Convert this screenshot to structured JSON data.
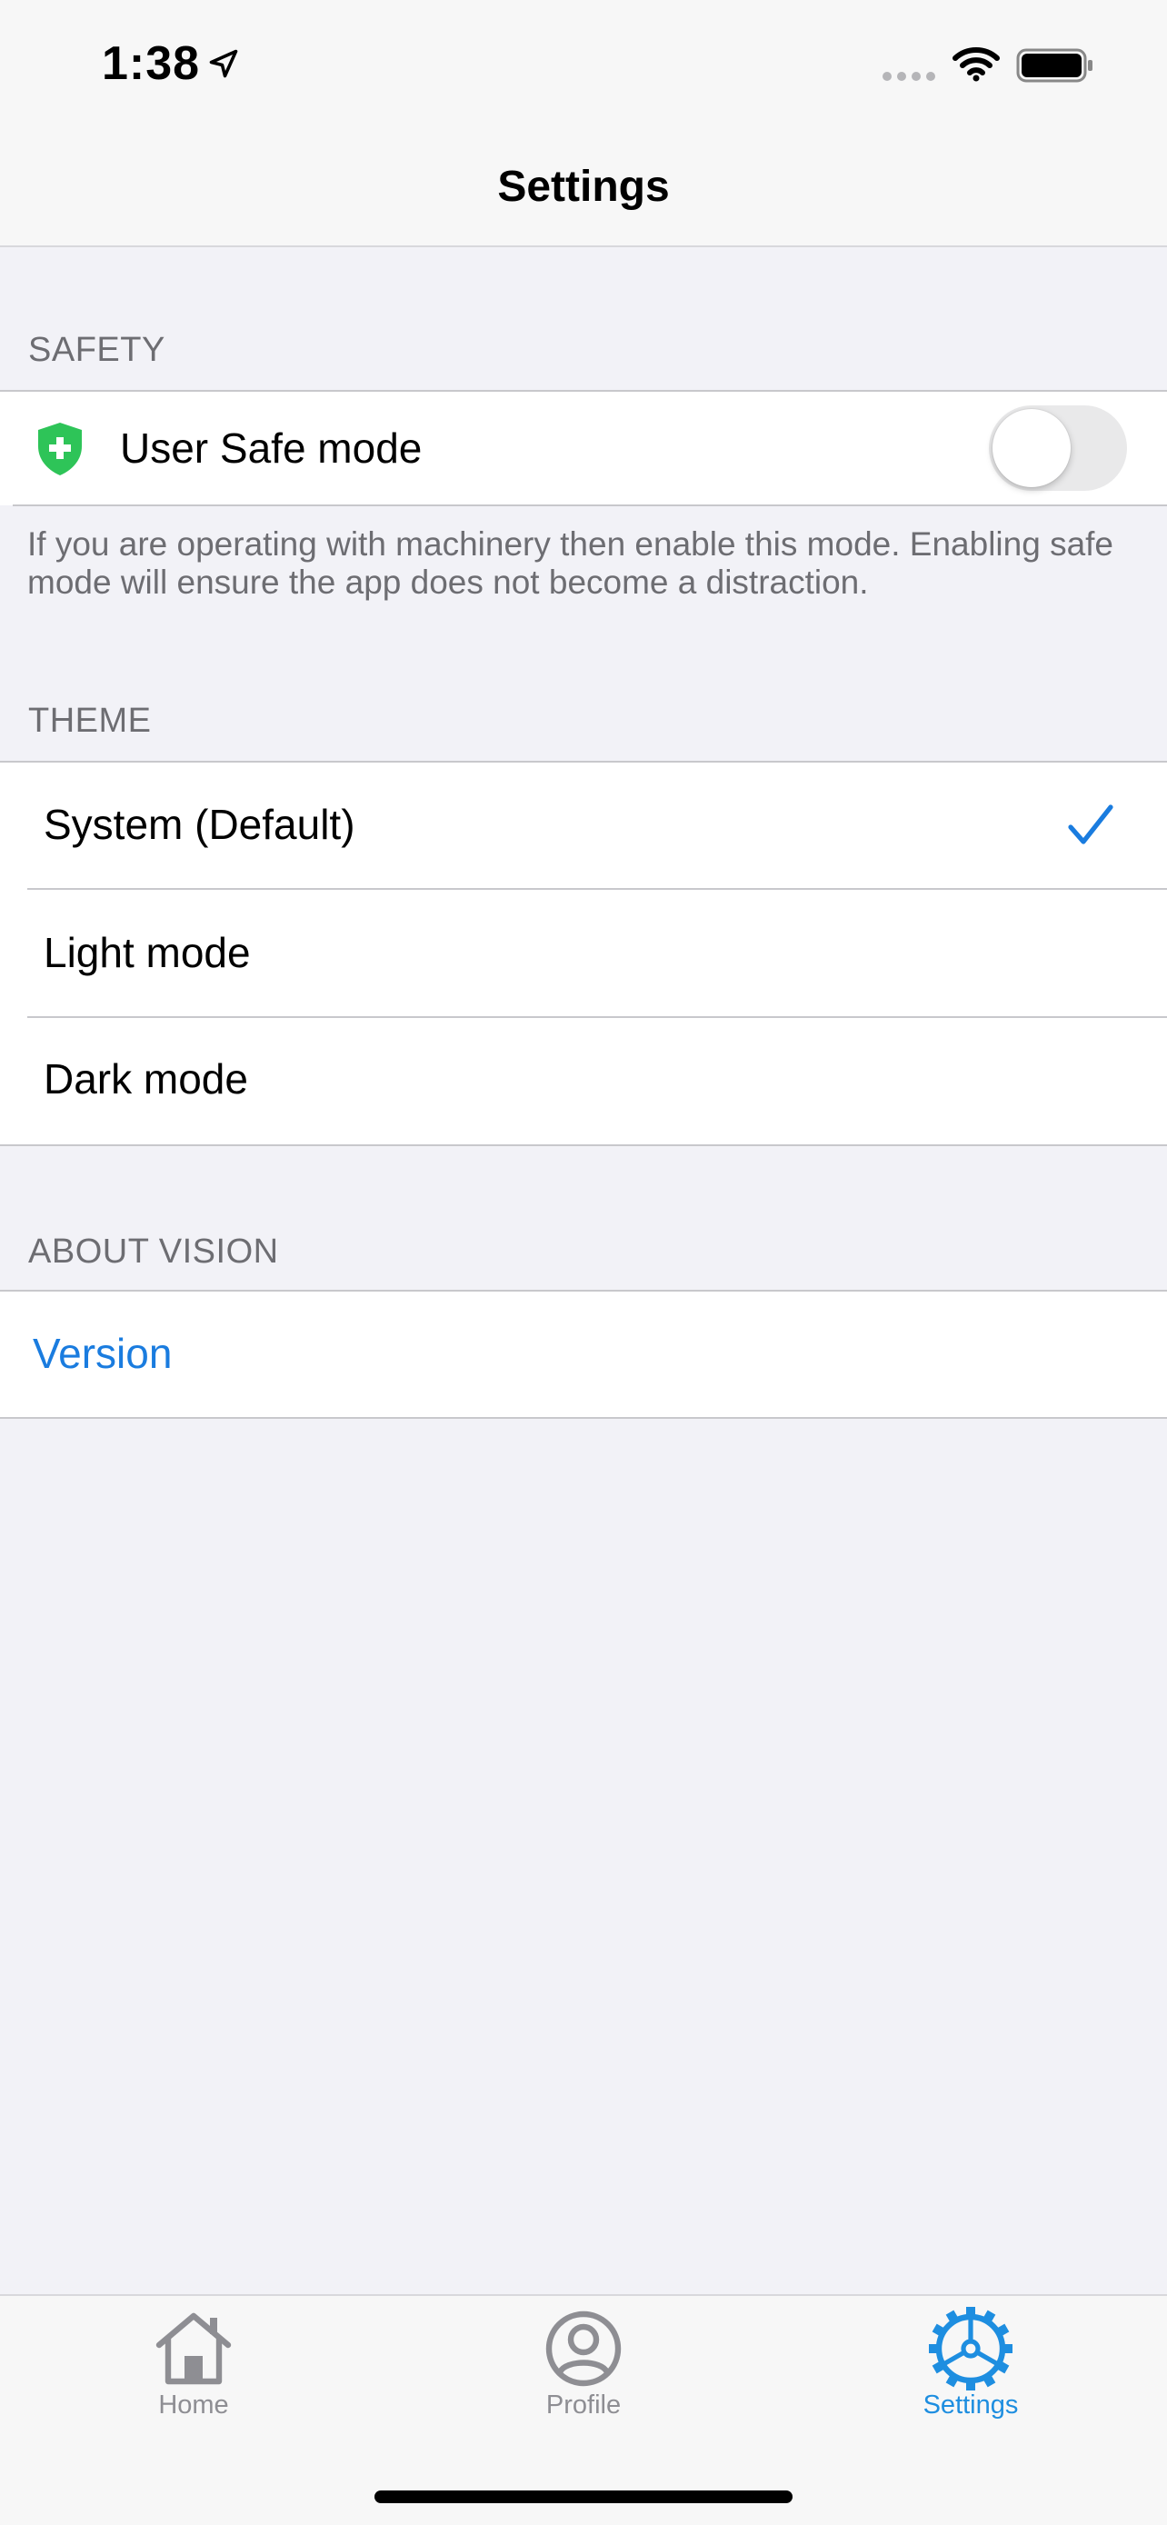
{
  "status_bar": {
    "time": "1:38",
    "icons": [
      "location-arrow-icon",
      "signal-icon",
      "wifi-icon",
      "battery-icon"
    ]
  },
  "nav": {
    "title": "Settings"
  },
  "sections": {
    "safety": {
      "header": "SAFETY",
      "item_label": "User Safe mode",
      "item_icon": "shield-plus-icon",
      "toggle_on": false,
      "footer": "If you are operating with machinery then enable this mode. Enabling safe mode will ensure the app does not become a distraction."
    },
    "theme": {
      "header": "THEME",
      "options": [
        {
          "label": "System (Default)",
          "selected": true
        },
        {
          "label": "Light mode",
          "selected": false
        },
        {
          "label": "Dark mode",
          "selected": false
        }
      ]
    },
    "about": {
      "header": "ABOUT VISION",
      "version_label": "Version"
    }
  },
  "tab_bar": {
    "tabs": [
      {
        "label": "Home",
        "icon": "home-icon",
        "active": false
      },
      {
        "label": "Profile",
        "icon": "profile-icon",
        "active": false
      },
      {
        "label": "Settings",
        "icon": "gear-icon",
        "active": true
      }
    ]
  },
  "colors": {
    "accent": "#1a7cdf",
    "shield_green": "#2ec458",
    "background": "#f2f2f7",
    "secondary_text": "#6d6d72",
    "separator": "#c8c8cc"
  }
}
